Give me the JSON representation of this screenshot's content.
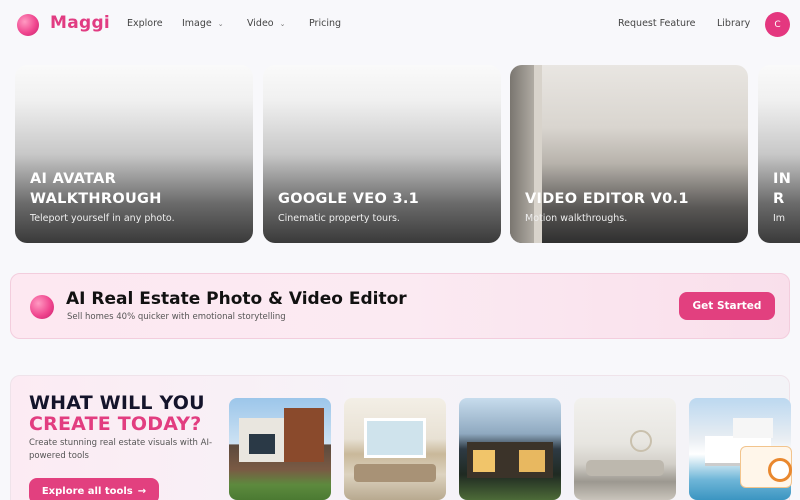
{
  "nav": {
    "brand": "Maggi",
    "items": [
      {
        "label": "Explore",
        "dropdown": false
      },
      {
        "label": "Image",
        "dropdown": true
      },
      {
        "label": "Video",
        "dropdown": true
      },
      {
        "label": "Pricing",
        "dropdown": false
      }
    ],
    "right": [
      "Request Feature",
      "Library"
    ],
    "avatar_initial": "C"
  },
  "cards": [
    {
      "title_line1": "AI AVATAR",
      "title_line2": "WALKTHROUGH",
      "subtitle": "Teleport yourself in any photo."
    },
    {
      "title_line1": "GOOGLE VEO 3.1",
      "title_line2": "",
      "subtitle": "Cinematic property tours."
    },
    {
      "title_line1": "VIDEO EDITOR V0.1",
      "title_line2": "",
      "subtitle": "Motion walkthroughs."
    },
    {
      "title_line1": "IN",
      "title_line2": "R",
      "subtitle": "Im"
    }
  ],
  "banner": {
    "title": "AI Real Estate Photo & Video Editor",
    "subtitle": "Sell homes 40% quicker with emotional storytelling",
    "button": "Get Started"
  },
  "create": {
    "heading_line1": "WHAT WILL YOU",
    "heading_line2": "CREATE TODAY?",
    "description": "Create stunning real estate visuals with AI-powered tools",
    "button": "Explore all tools",
    "button_icon": "arrow-right-icon"
  },
  "colors": {
    "accent": "#e2407f",
    "brand": "#e13c82",
    "dark_heading": "#14142b"
  }
}
